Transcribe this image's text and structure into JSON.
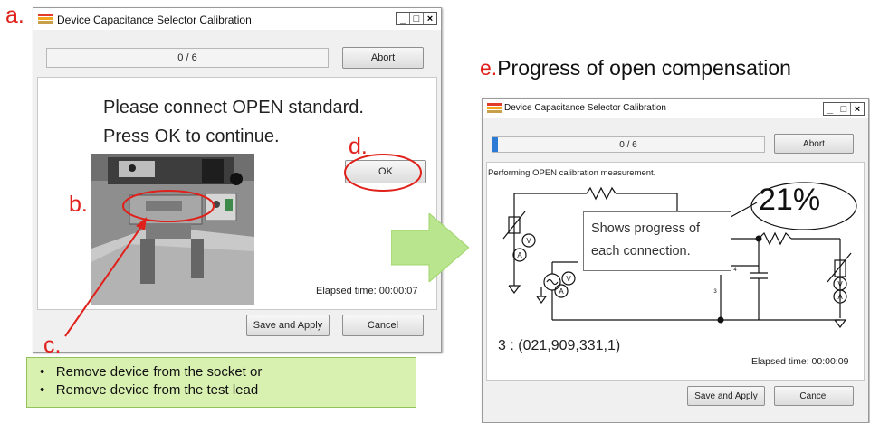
{
  "annotations": {
    "a": "a.",
    "b": "b.",
    "c": "c.",
    "d": "d.",
    "e_letter": "e.",
    "e_text": "Progress of open compensation"
  },
  "window_a": {
    "title": "Device Capacitance Selector Calibration",
    "caption_buttons": [
      "_",
      "□",
      "×"
    ],
    "progress_text": "0 / 6",
    "progress_fraction": 0.0,
    "abort_label": "Abort",
    "message_line1": "Please connect OPEN standard.",
    "message_line2": "Press OK to continue.",
    "ok_label": "OK",
    "photo_label": "",
    "elapsed": "Elapsed time:  00:00:07",
    "save_apply_label": "Save and Apply",
    "cancel_label": "Cancel"
  },
  "window_e": {
    "title": "Device Capacitance Selector Calibration",
    "caption_buttons": [
      "_",
      "□",
      "×"
    ],
    "progress_text": "0 / 6",
    "progress_fraction": 0.02,
    "abort_label": "Abort",
    "status": "Performing OPEN calibration measurement.",
    "percent": "21%",
    "callout": "Shows progress of each connection.",
    "callout_line1": "Shows progress of",
    "callout_line2": "each connection.",
    "node_labels": [
      "2",
      "4",
      "3"
    ],
    "meter_labels": [
      "V",
      "A"
    ],
    "connection_info": "3 :  (021,909,331,1)",
    "elapsed": "Elapsed time:  00:00:09",
    "save_apply_label": "Save and Apply",
    "cancel_label": "Cancel"
  },
  "note_box": {
    "items": [
      "Remove device from the socket or",
      "Remove device from the test lead"
    ]
  },
  "colors": {
    "annotation_red": "#e0201a",
    "progress_blue": "#2b7bd6",
    "arrow_green": "#b9e58e",
    "note_green": "#d8f0b0"
  }
}
